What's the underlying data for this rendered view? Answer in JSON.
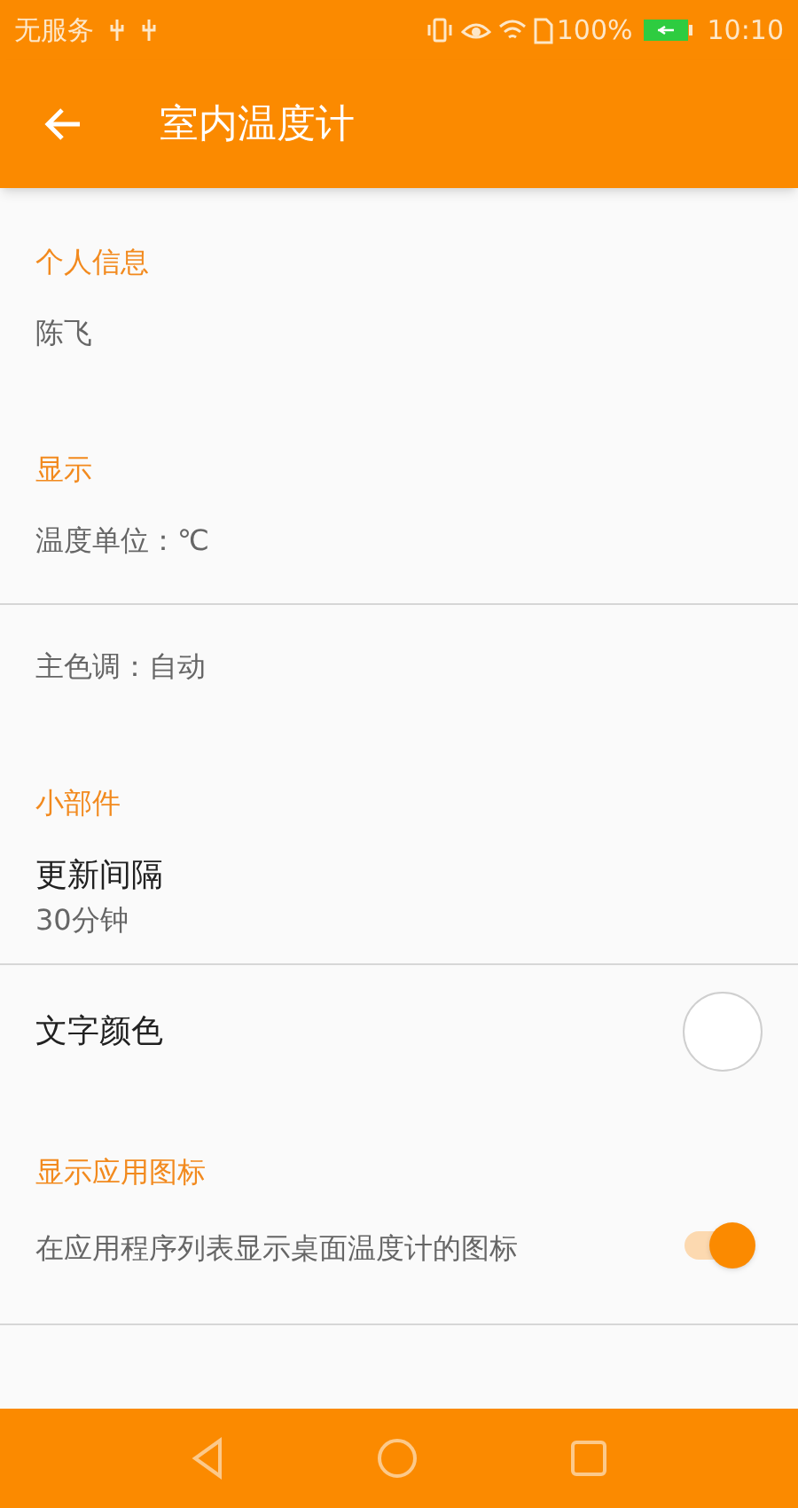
{
  "status_bar": {
    "carrier": "无服务",
    "battery": "100%",
    "time": "10:10"
  },
  "app_bar": {
    "title": "室内温度计"
  },
  "sections": [
    {
      "title": "个人信息",
      "items": [
        {
          "kind": "summary",
          "text": "陈飞"
        }
      ]
    },
    {
      "title": "显示",
      "items": [
        {
          "kind": "summary",
          "text": "温度单位：℃"
        },
        {
          "kind": "summary",
          "text": "主色调：自动"
        }
      ]
    },
    {
      "title": "小部件",
      "items": [
        {
          "kind": "two_line",
          "title": "更新间隔",
          "summary": "30分钟"
        },
        {
          "kind": "color",
          "title": "文字颜色",
          "color": "#ffffff"
        }
      ]
    },
    {
      "title": "显示应用图标",
      "items": [
        {
          "kind": "switch",
          "text": "在应用程序列表显示桌面温度计的图标",
          "on": true
        }
      ]
    }
  ]
}
